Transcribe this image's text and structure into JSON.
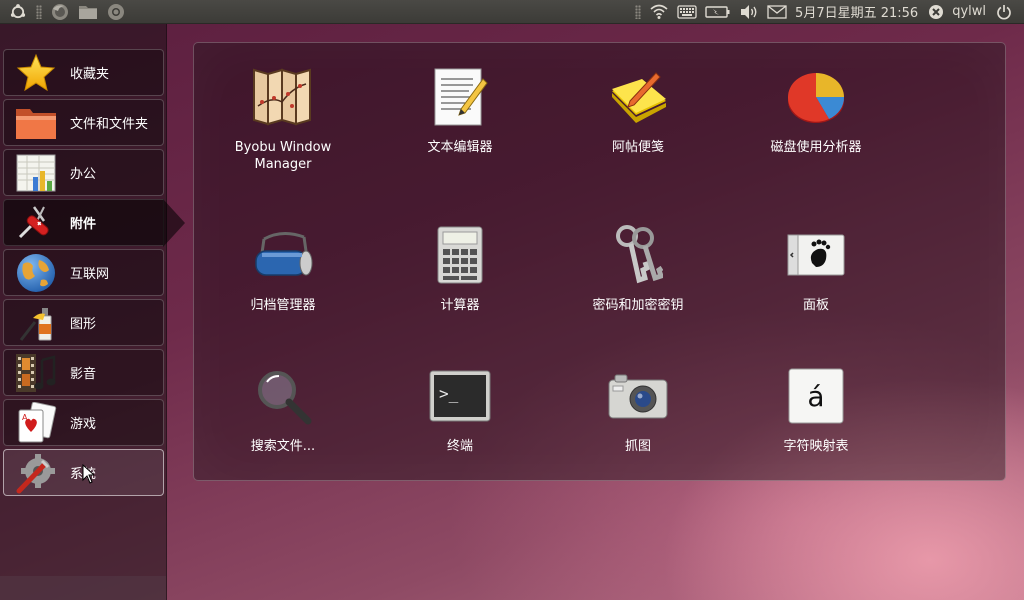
{
  "top_panel": {
    "left_icons": [
      "ubuntu-logo-icon",
      "firefox-icon",
      "files-folder-icon",
      "help-icon"
    ],
    "indicators": [
      "wifi-icon",
      "keyboard-icon",
      "battery-icon",
      "volume-icon",
      "mail-icon"
    ],
    "datetime": "5月7日星期五 21:56",
    "username": "qylwl"
  },
  "sidebar": {
    "items": [
      {
        "label": "收藏夹",
        "icon": "star-icon",
        "active": false
      },
      {
        "label": "文件和文件夹",
        "icon": "folder-icon",
        "active": false
      },
      {
        "label": "办公",
        "icon": "office-chart-icon",
        "active": false
      },
      {
        "label": "附件",
        "icon": "swiss-knife-icon",
        "active": true
      },
      {
        "label": "互联网",
        "icon": "globe-icon",
        "active": false
      },
      {
        "label": "图形",
        "icon": "paint-tube-icon",
        "active": false
      },
      {
        "label": "影音",
        "icon": "film-music-icon",
        "active": false
      },
      {
        "label": "游戏",
        "icon": "cards-icon",
        "active": false
      },
      {
        "label": "系统",
        "icon": "wrench-gear-icon",
        "active": false
      }
    ]
  },
  "apps": [
    {
      "label": "Byobu Window Manager",
      "icon": "folding-screen-icon"
    },
    {
      "label": "文本编辑器",
      "icon": "text-editor-icon"
    },
    {
      "label": "阿帖便笺",
      "icon": "sticky-note-icon"
    },
    {
      "label": "磁盘使用分析器",
      "icon": "pie-chart-icon"
    },
    {
      "label": "归档管理器",
      "icon": "archive-roller-icon"
    },
    {
      "label": "计算器",
      "icon": "calculator-icon"
    },
    {
      "label": "密码和加密密钥",
      "icon": "keys-icon"
    },
    {
      "label": "面板",
      "icon": "gnome-foot-icon"
    },
    {
      "label": "搜索文件...",
      "icon": "magnifier-icon"
    },
    {
      "label": "终端",
      "icon": "terminal-icon"
    },
    {
      "label": "抓图",
      "icon": "camera-icon"
    },
    {
      "label": "字符映射表",
      "icon": "character-map-icon"
    }
  ],
  "character_map_glyph": "á",
  "terminal_prompt": ">_",
  "colors": {
    "panel_bg": "#3c3b37",
    "accent_orange": "#f07746",
    "wallpaper_purple": "#6e2a4a"
  }
}
